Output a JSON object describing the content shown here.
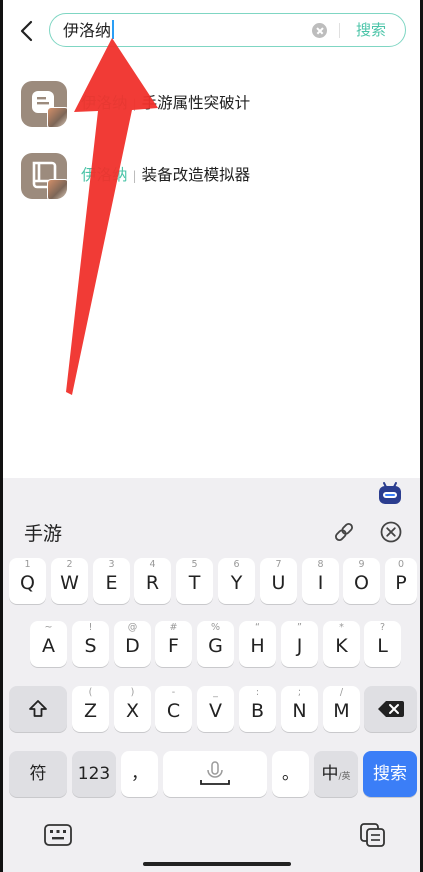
{
  "search": {
    "value": "伊洛纳",
    "button_label": "搜索"
  },
  "results": [
    {
      "prefix": "伊洛纳",
      "name": "手游属性突破计"
    },
    {
      "prefix": "伊洛纳",
      "name": "装备改造模拟器"
    }
  ],
  "keyboard": {
    "candidate": "手游",
    "row1": [
      {
        "hint": "1",
        "label": "Q"
      },
      {
        "hint": "2",
        "label": "W"
      },
      {
        "hint": "3",
        "label": "E"
      },
      {
        "hint": "4",
        "label": "R"
      },
      {
        "hint": "5",
        "label": "T"
      },
      {
        "hint": "6",
        "label": "Y"
      },
      {
        "hint": "7",
        "label": "U"
      },
      {
        "hint": "8",
        "label": "I"
      },
      {
        "hint": "9",
        "label": "O"
      },
      {
        "hint": "0",
        "label": "P"
      }
    ],
    "row2": [
      {
        "hint": "~",
        "label": "A"
      },
      {
        "hint": "!",
        "label": "S"
      },
      {
        "hint": "@",
        "label": "D"
      },
      {
        "hint": "#",
        "label": "F"
      },
      {
        "hint": "%",
        "label": "G"
      },
      {
        "hint": "“",
        "label": "H"
      },
      {
        "hint": "”",
        "label": "J"
      },
      {
        "hint": "*",
        "label": "K"
      },
      {
        "hint": "?",
        "label": "L"
      }
    ],
    "row3": [
      {
        "hint": "(",
        "label": "Z"
      },
      {
        "hint": ")",
        "label": "X"
      },
      {
        "hint": "-",
        "label": "C"
      },
      {
        "hint": "_",
        "label": "V"
      },
      {
        "hint": ":",
        "label": "B"
      },
      {
        "hint": ";",
        "label": "N"
      },
      {
        "hint": "/",
        "label": "M"
      }
    ],
    "symbol_key": "符",
    "number_key": "123",
    "comma_key": "，",
    "period_key": "。",
    "lang_key": "中",
    "lang_sub": "/英",
    "enter_key": "搜索"
  },
  "colors": {
    "accent": "#4bc4a8",
    "enter": "#3b7ef7",
    "arrow": "#f0302b"
  }
}
